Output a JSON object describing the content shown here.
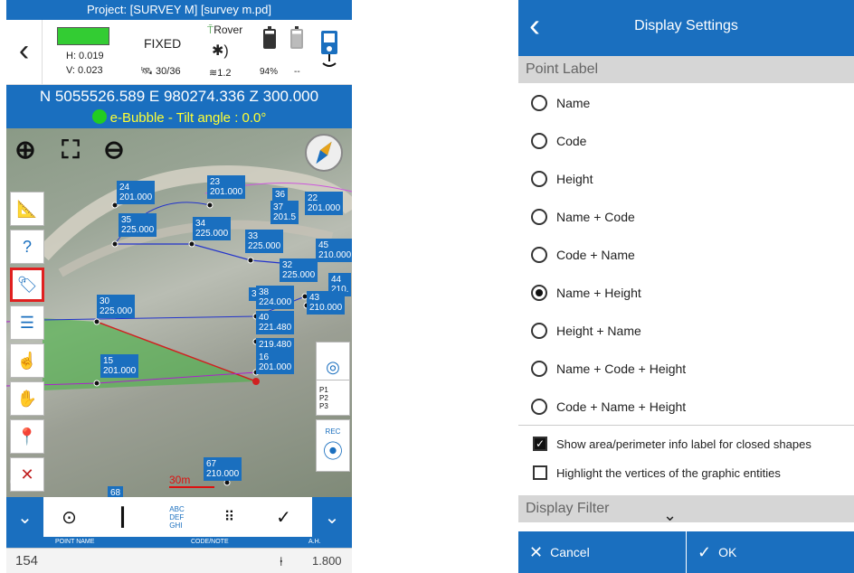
{
  "left": {
    "title": "Project: [SURVEY M] [survey m.pd]",
    "status": {
      "h_acc": "H: 0.019",
      "v_acc": "V: 0.023",
      "solution": "FIXED",
      "satellites": "30/36",
      "rover": "Rover",
      "age": "1.2",
      "battery_1": "94%",
      "battery_2": "--"
    },
    "coords": "N 5055526.589   E 980274.336   Z 300.000",
    "bubble": "e-Bubble - Tilt angle : 0.0°",
    "map_labels": [
      {
        "text": "24\n201.000"
      },
      {
        "text": "23\n201.000"
      },
      {
        "text": "36"
      },
      {
        "text": "22\n201.000"
      },
      {
        "text": "37\n201.5"
      },
      {
        "text": "35\n225.000"
      },
      {
        "text": "34\n225.000"
      },
      {
        "text": "33\n225.000"
      },
      {
        "text": "45\n210.000"
      },
      {
        "text": "32\n225.000"
      },
      {
        "text": "44\n210."
      },
      {
        "text": "3"
      },
      {
        "text": "38\n224.000"
      },
      {
        "text": "43\n210.000"
      },
      {
        "text": "30\n225.000"
      },
      {
        "text": "40\n221.480"
      },
      {
        "text": "219.480"
      },
      {
        "text": "15\n201.000"
      },
      {
        "text": "16\n201.000"
      },
      {
        "text": "67\n210.000"
      },
      {
        "text": "68"
      }
    ],
    "scale": "30m",
    "google": "gle",
    "right_tools": {
      "rec": "REC",
      "p1": "P1",
      "p2": "P2",
      "p3": "P3"
    },
    "bottom_tools": {
      "abc": "ABC\nDEF\nGHI"
    },
    "field_headers": {
      "point_name": "POINT NAME",
      "code": "CODE/NOTE",
      "ah": "A.H."
    },
    "fields": {
      "point_name": "154",
      "code": "",
      "ah": "1.800"
    }
  },
  "right": {
    "title": "Display Settings",
    "section_point_label": "Point Label",
    "options": [
      {
        "label": "Name",
        "selected": false
      },
      {
        "label": "Code",
        "selected": false
      },
      {
        "label": "Height",
        "selected": false
      },
      {
        "label": "Name + Code",
        "selected": false
      },
      {
        "label": "Code + Name",
        "selected": false
      },
      {
        "label": "Name + Height",
        "selected": true
      },
      {
        "label": "Height + Name",
        "selected": false
      },
      {
        "label": "Name + Code + Height",
        "selected": false
      },
      {
        "label": "Code + Name + Height",
        "selected": false
      }
    ],
    "check_area": {
      "label": "Show area/perimeter info label for closed shapes",
      "checked": true
    },
    "check_vertices": {
      "label": "Highlight the vertices of the graphic entities",
      "checked": false
    },
    "section_filter": "Display Filter",
    "cancel": "Cancel",
    "ok": "OK"
  },
  "colors": {
    "accent": "#1a6fbf",
    "bubble_text": "#ffff33",
    "fix_green": "#33cc33",
    "highlight": "#e02020"
  }
}
